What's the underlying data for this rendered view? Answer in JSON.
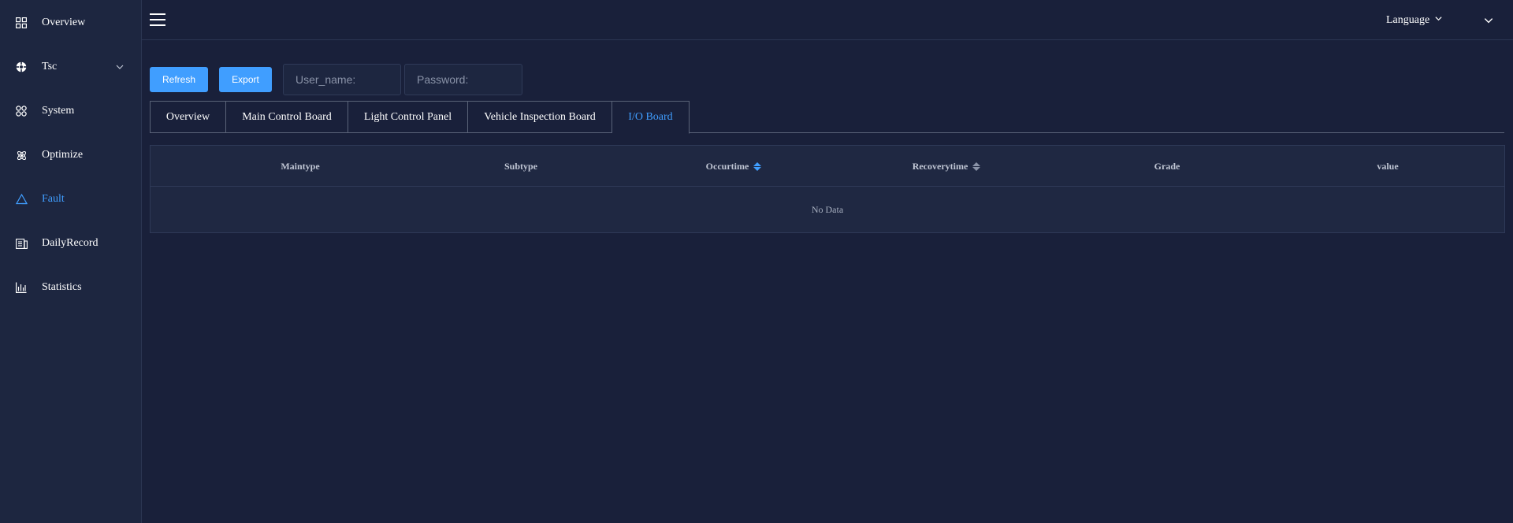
{
  "sidebar": {
    "items": [
      {
        "label": "Overview",
        "icon": "grid-icon"
      },
      {
        "label": "Tsc",
        "icon": "target-icon",
        "has_submenu": true
      },
      {
        "label": "System",
        "icon": "apps-icon"
      },
      {
        "label": "Optimize",
        "icon": "atom-icon"
      },
      {
        "label": "Fault",
        "icon": "warning-triangle-icon",
        "active": true
      },
      {
        "label": "DailyRecord",
        "icon": "document-icon"
      },
      {
        "label": "Statistics",
        "icon": "bar-chart-icon"
      }
    ]
  },
  "header": {
    "language_label": "Language"
  },
  "toolbar": {
    "refresh_label": "Refresh",
    "export_label": "Export",
    "username_placeholder": "User_name:",
    "password_placeholder": "Password:"
  },
  "tabs": [
    {
      "label": "Overview"
    },
    {
      "label": "Main Control Board"
    },
    {
      "label": "Light Control Panel"
    },
    {
      "label": "Vehicle Inspection Board"
    },
    {
      "label": "I/O Board",
      "active": true
    }
  ],
  "table": {
    "columns": [
      "Maintype",
      "Subtype",
      "Occurtime",
      "Recoverytime",
      "Grade",
      "value"
    ],
    "sortable": [
      "Occurtime",
      "Recoverytime"
    ],
    "empty_text": "No Data"
  },
  "colors": {
    "accent": "#409eff",
    "background": "#19203a",
    "sidebar": "#1d2640"
  }
}
